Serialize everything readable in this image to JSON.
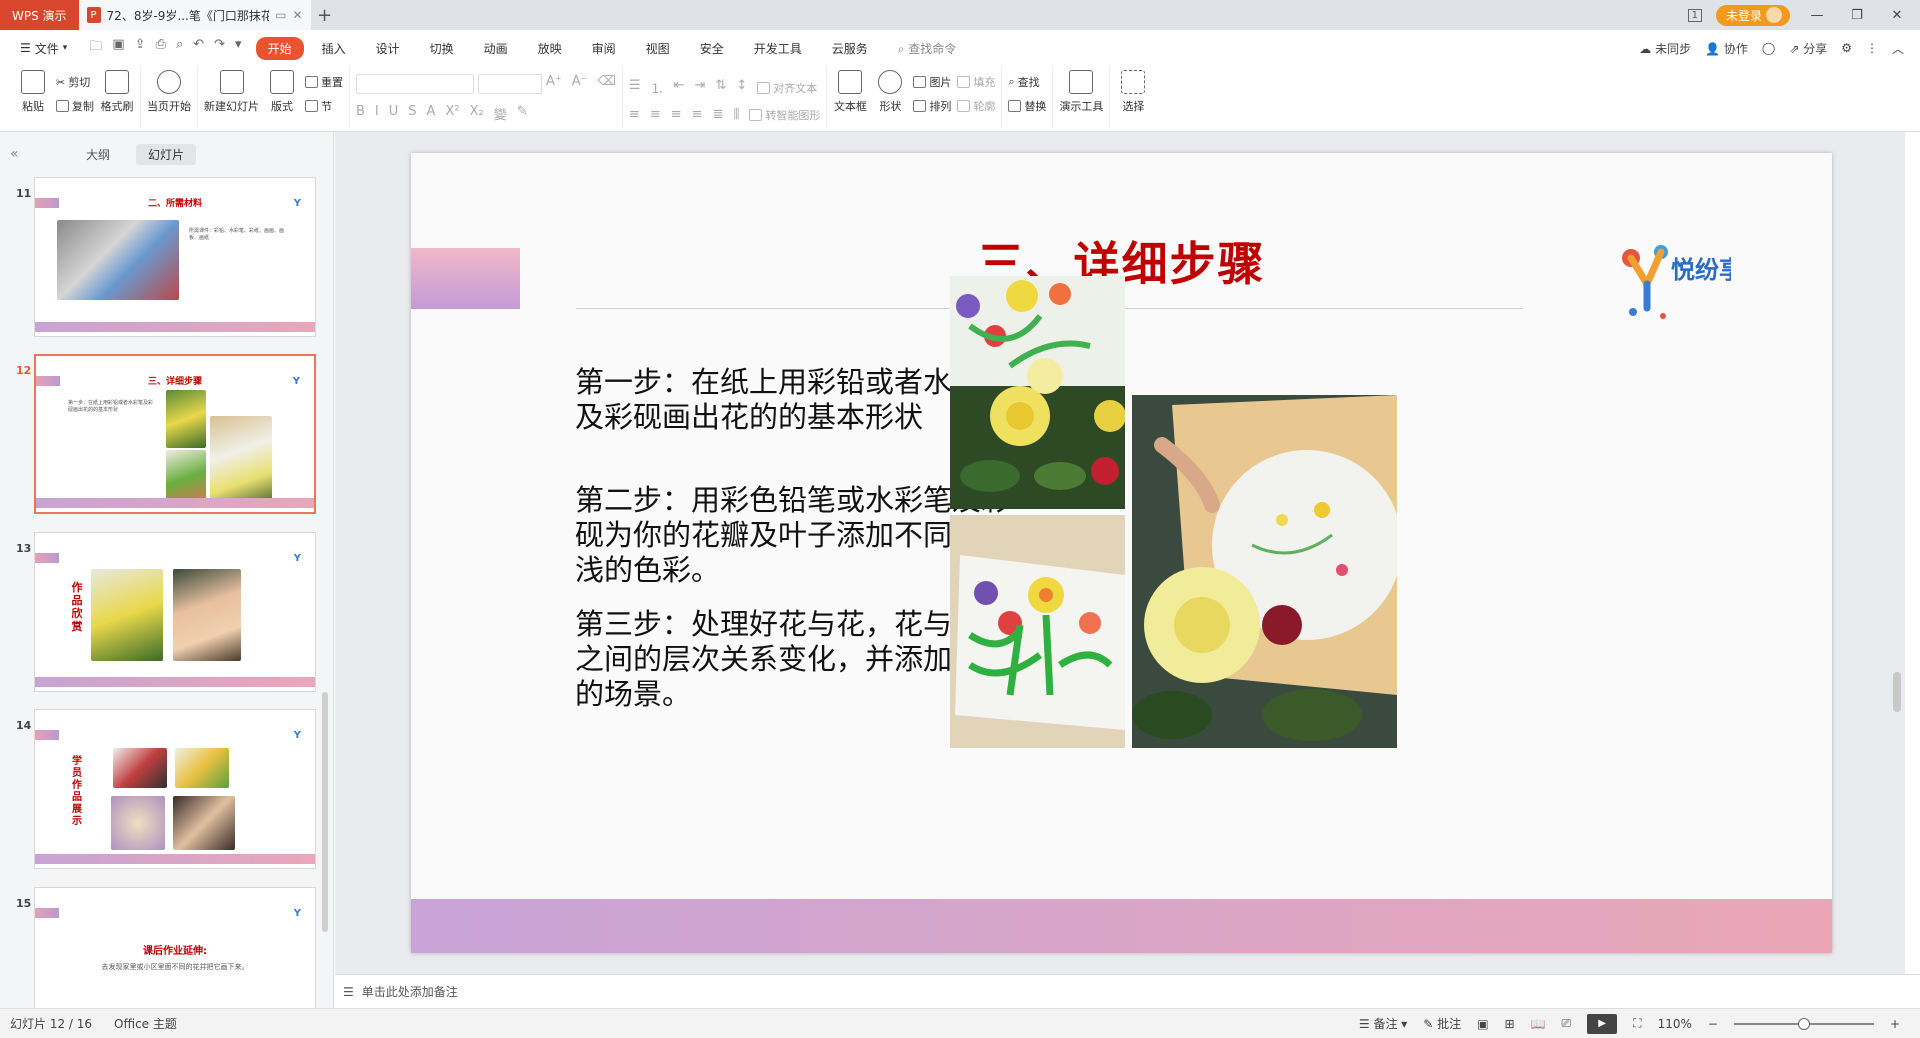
{
  "titlebar": {
    "app_label": "WPS 演示",
    "doc_title": "72、8岁-9岁...笔《门口那抹花》",
    "page_indicator": "1",
    "login_label": "未登录"
  },
  "menu": {
    "file_label": "文件",
    "tabs": [
      "开始",
      "插入",
      "设计",
      "切换",
      "动画",
      "放映",
      "审阅",
      "视图",
      "安全",
      "开发工具",
      "云服务"
    ],
    "active_tab": "开始",
    "find_command": "查找命令",
    "right": {
      "sync": "未同步",
      "collab": "协作",
      "share": "分享"
    }
  },
  "ribbon": {
    "paste": "粘贴",
    "cut": "剪切",
    "copy": "复制",
    "format_painter": "格式刷",
    "from_current": "当页开始",
    "new_slide": "新建幻灯片",
    "layout": "版式",
    "reset": "重置",
    "section": "节",
    "align_text": "对齐文本",
    "smart_shape": "转智能图形",
    "textbox": "文本框",
    "shape": "形状",
    "picture": "图片",
    "arrange": "排列",
    "fill": "填充",
    "outline": "轮廓",
    "find": "查找",
    "replace": "替换",
    "presentation_tools": "演示工具",
    "select": "选择"
  },
  "left_panel": {
    "tab_outline": "大纲",
    "tab_slides": "幻灯片",
    "thumbs": [
      {
        "num": "11",
        "title": "二、所需材料",
        "text": "所需课件：彩铅、水彩笔、彩纸、画画、画板、画纸"
      },
      {
        "num": "12",
        "title": "三、详细步骤",
        "text": "第一步：在纸上用彩铅或者水彩笔及彩砚画出花的的基本形状"
      },
      {
        "num": "13",
        "title": "作品欣赏",
        "text": ""
      },
      {
        "num": "14",
        "title": "学员作品展示",
        "text": ""
      },
      {
        "num": "15",
        "title": "课后作业延伸:",
        "text": "去发现家里或小区里面不同的花并把它画下来。"
      }
    ]
  },
  "slide": {
    "title": "三、详细步骤",
    "steps": [
      "第一步：在纸上用彩铅或者水彩笔及彩砚画出花的的基本形状",
      "第二步：用彩色铅笔或水彩笔及彩砚为你的花瓣及叶子添加不同的深浅的色彩。",
      "第三步：处理好花与花，花与叶子之间的层次关系变化，并添加相应的场景。"
    ],
    "logo_text": "悦纷享"
  },
  "notes": {
    "placeholder": "单击此处添加备注"
  },
  "status": {
    "slide_counter": "幻灯片 12 / 16",
    "theme": "Office 主题",
    "notes_btn": "备注",
    "comments_btn": "批注",
    "zoom": "110%",
    "zoom_fraction": 0.5
  },
  "colors": {
    "accent": "#e8542e",
    "title_red": "#c00000",
    "band_start": "#c8a4d8",
    "band_end": "#eaa6b6"
  }
}
